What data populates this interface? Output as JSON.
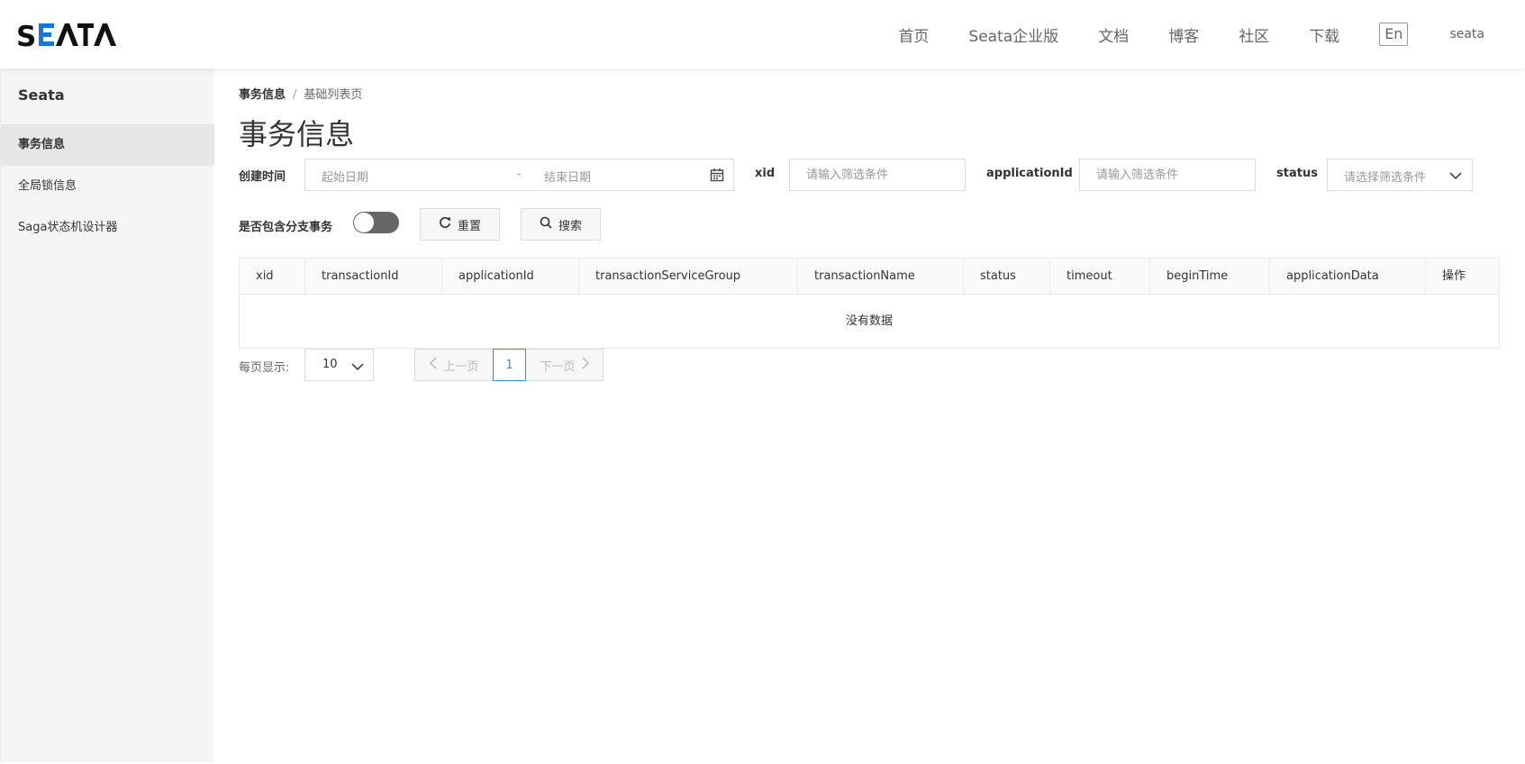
{
  "header": {
    "logo_text": "SEATA",
    "nav": [
      {
        "label": "首页"
      },
      {
        "label": "Seata企业版"
      },
      {
        "label": "文档"
      },
      {
        "label": "博客"
      },
      {
        "label": "社区"
      },
      {
        "label": "下载"
      }
    ],
    "lang_label": "En",
    "user_label": "seata"
  },
  "sidebar": {
    "title": "Seata",
    "items": [
      {
        "label": "事务信息",
        "active": true
      },
      {
        "label": "全局锁信息",
        "active": false
      },
      {
        "label": "Saga状态机设计器",
        "active": false
      }
    ]
  },
  "breadcrumb": {
    "first": "事务信息",
    "separator": "/",
    "second": "基础列表页"
  },
  "page_title": "事务信息",
  "filters": {
    "create_time_label": "创建时间",
    "start_date_placeholder": "起始日期",
    "date_separator": "-",
    "end_date_placeholder": "结束日期",
    "xid_label": "xid",
    "xid_placeholder": "请输入筛选条件",
    "application_id_label": "applicationId",
    "application_id_placeholder": "请输入筛选条件",
    "status_label": "status",
    "status_placeholder": "请选择筛选条件",
    "include_branch_label": "是否包含分支事务",
    "reset_label": "重置",
    "search_label": "搜索"
  },
  "table": {
    "columns": [
      "xid",
      "transactionId",
      "applicationId",
      "transactionServiceGroup",
      "transactionName",
      "status",
      "timeout",
      "beginTime",
      "applicationData",
      "操作"
    ],
    "empty_text": "没有数据"
  },
  "pagination": {
    "page_size_label": "每页显示:",
    "page_size_value": "10",
    "prev_label": "上一页",
    "current_page": "1",
    "next_label": "下一页"
  },
  "colors": {
    "accent_blue": "#3c8dde",
    "logo_blue": "#1976d2",
    "toggle_off": "#666666"
  }
}
